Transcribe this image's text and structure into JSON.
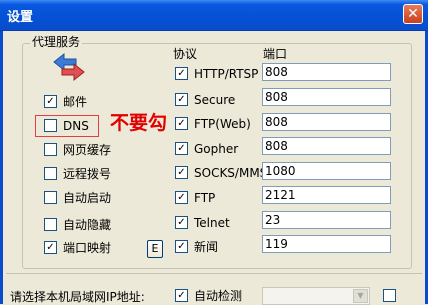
{
  "window": {
    "title": "设置",
    "close_glyph": "✕"
  },
  "group": {
    "title": "代理服务"
  },
  "columns": {
    "protocol": "协议",
    "port": "端口"
  },
  "services": [
    {
      "label": "邮件",
      "checked": true
    },
    {
      "label": "DNS",
      "checked": false
    },
    {
      "label": "网页缓存",
      "checked": false
    },
    {
      "label": "远程拨号",
      "checked": false
    },
    {
      "label": "自动启动",
      "checked": false
    },
    {
      "label": "自动隐藏",
      "checked": false
    },
    {
      "label": "端口映射",
      "checked": true
    }
  ],
  "mapping_button": "E",
  "protocols": [
    {
      "label": "HTTP/RTSP",
      "checked": true,
      "port": "808"
    },
    {
      "label": "Secure",
      "checked": true,
      "port": "808"
    },
    {
      "label": "FTP(Web)",
      "checked": true,
      "port": "808"
    },
    {
      "label": "Gopher",
      "checked": true,
      "port": "808"
    },
    {
      "label": "SOCKS/MMS",
      "checked": true,
      "port": "1080"
    },
    {
      "label": "FTP",
      "checked": true,
      "port": "2121"
    },
    {
      "label": "Telnet",
      "checked": true,
      "port": "23"
    },
    {
      "label": "新闻",
      "checked": true,
      "port": "119"
    }
  ],
  "annotation": {
    "text": "不要勾",
    "color": "#e00000"
  },
  "lan": {
    "label": "请选择本机局域网IP地址:",
    "auto_detect_label": "自动检测",
    "auto_detect_checked": true
  },
  "icons": {
    "proxy": "proxy-arrows-icon",
    "close": "close-icon"
  }
}
